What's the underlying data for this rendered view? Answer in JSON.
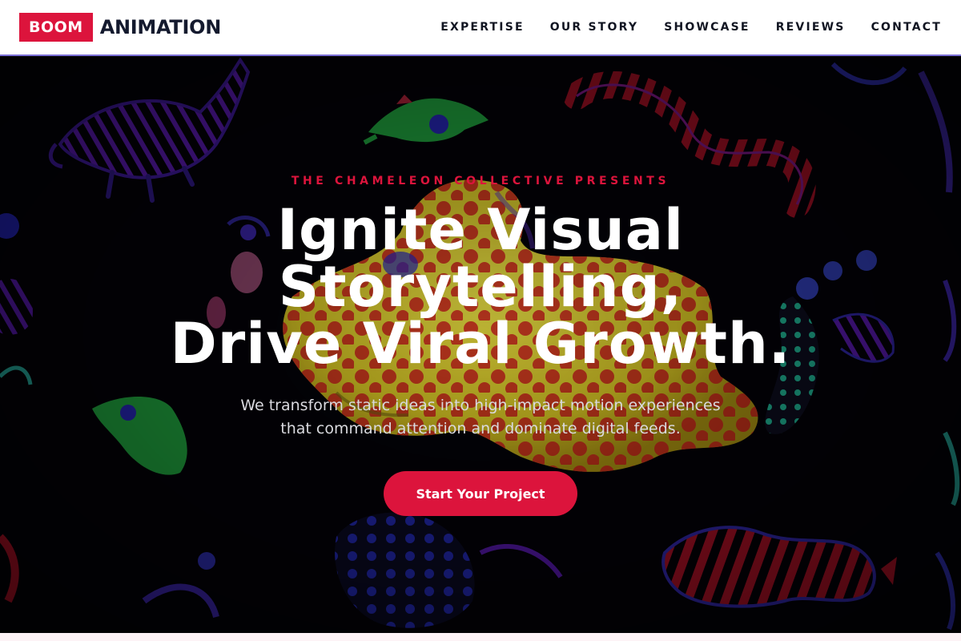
{
  "header": {
    "logo_badge": "BOOM",
    "logo_word": "ANIMATION",
    "nav": [
      {
        "label": "EXPERTISE"
      },
      {
        "label": "OUR STORY"
      },
      {
        "label": "SHOWCASE"
      },
      {
        "label": "REVIEWS"
      },
      {
        "label": "CONTACT"
      }
    ]
  },
  "hero": {
    "eyebrow": "THE CHAMELEON COLLECTIVE PRESENTS",
    "headline_line1": "Ignite Visual",
    "headline_line2": "Storytelling,",
    "headline_line3": "Drive Viral Growth.",
    "subhead_line1": "We transform static ideas into high-impact motion experiences",
    "subhead_line2": "that command attention and dominate digital feeds.",
    "cta_label": "Start Your Project"
  },
  "colors": {
    "accent": "#dc143c",
    "header_border": "#7b6fd6",
    "text_dark": "#141a2e",
    "hero_bg": "#040309"
  }
}
